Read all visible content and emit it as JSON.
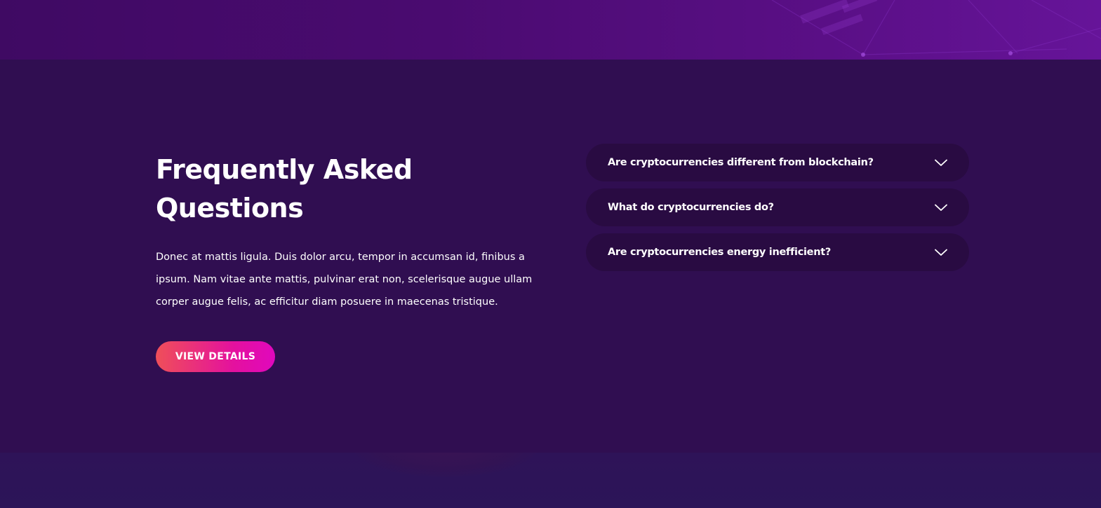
{
  "faq": {
    "title_line1": "Frequently Asked",
    "title_line2": "Questions",
    "description": "Donec at mattis ligula. Duis dolor arcu, tempor in accumsan id, finibus a ipsum. Nam vitae ante mattis, pulvinar erat non, scelerisque augue ullam corper augue felis, ac efficitur diam posuere in maecenas tristique.",
    "button_label": "VIEW DETAILS",
    "items": [
      {
        "question": "Are cryptocurrencies different from blockchain?",
        "icon": "chevron-down-icon"
      },
      {
        "question": "What do cryptocurrencies do?",
        "icon": "chevron-down-icon"
      },
      {
        "question": "Are cryptocurrencies energy inefficient?",
        "icon": "chevron-down-icon"
      }
    ]
  },
  "colors": {
    "background": "#300e51",
    "accordion_item": "#290b42",
    "button_gradient_start": "#ef4f59",
    "button_gradient_end": "#e008bd",
    "text": "#ffffff"
  }
}
